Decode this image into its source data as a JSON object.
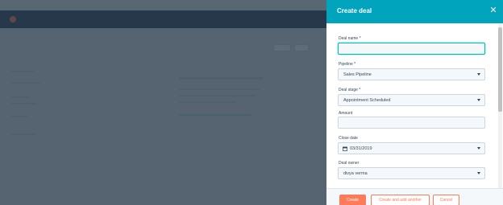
{
  "panel": {
    "title": "Create deal",
    "fields": {
      "deal_name": {
        "label": "Deal name *",
        "value": ""
      },
      "pipeline": {
        "label": "Pipeline *",
        "value": "Sales Pipeline"
      },
      "deal_stage": {
        "label": "Deal stage *",
        "value": "Appointment Scheduled"
      },
      "amount": {
        "label": "Amount",
        "value": ""
      },
      "close_date": {
        "label": "Close date",
        "value": "03/31/2019"
      },
      "deal_owner": {
        "label": "Deal owner",
        "value": "divya verma"
      }
    },
    "footer": {
      "create_label": "Create",
      "create_add_label": "Create and add another",
      "cancel_label": "Cancel"
    }
  },
  "colors": {
    "header": "#00a4bd",
    "primary_button": "#ff7a59",
    "nav_bar": "#33475b",
    "focus_border": "#00bda5"
  },
  "icons": {
    "close": "close-icon",
    "dropdown": "chevron-down-icon",
    "calendar": "calendar-icon"
  }
}
